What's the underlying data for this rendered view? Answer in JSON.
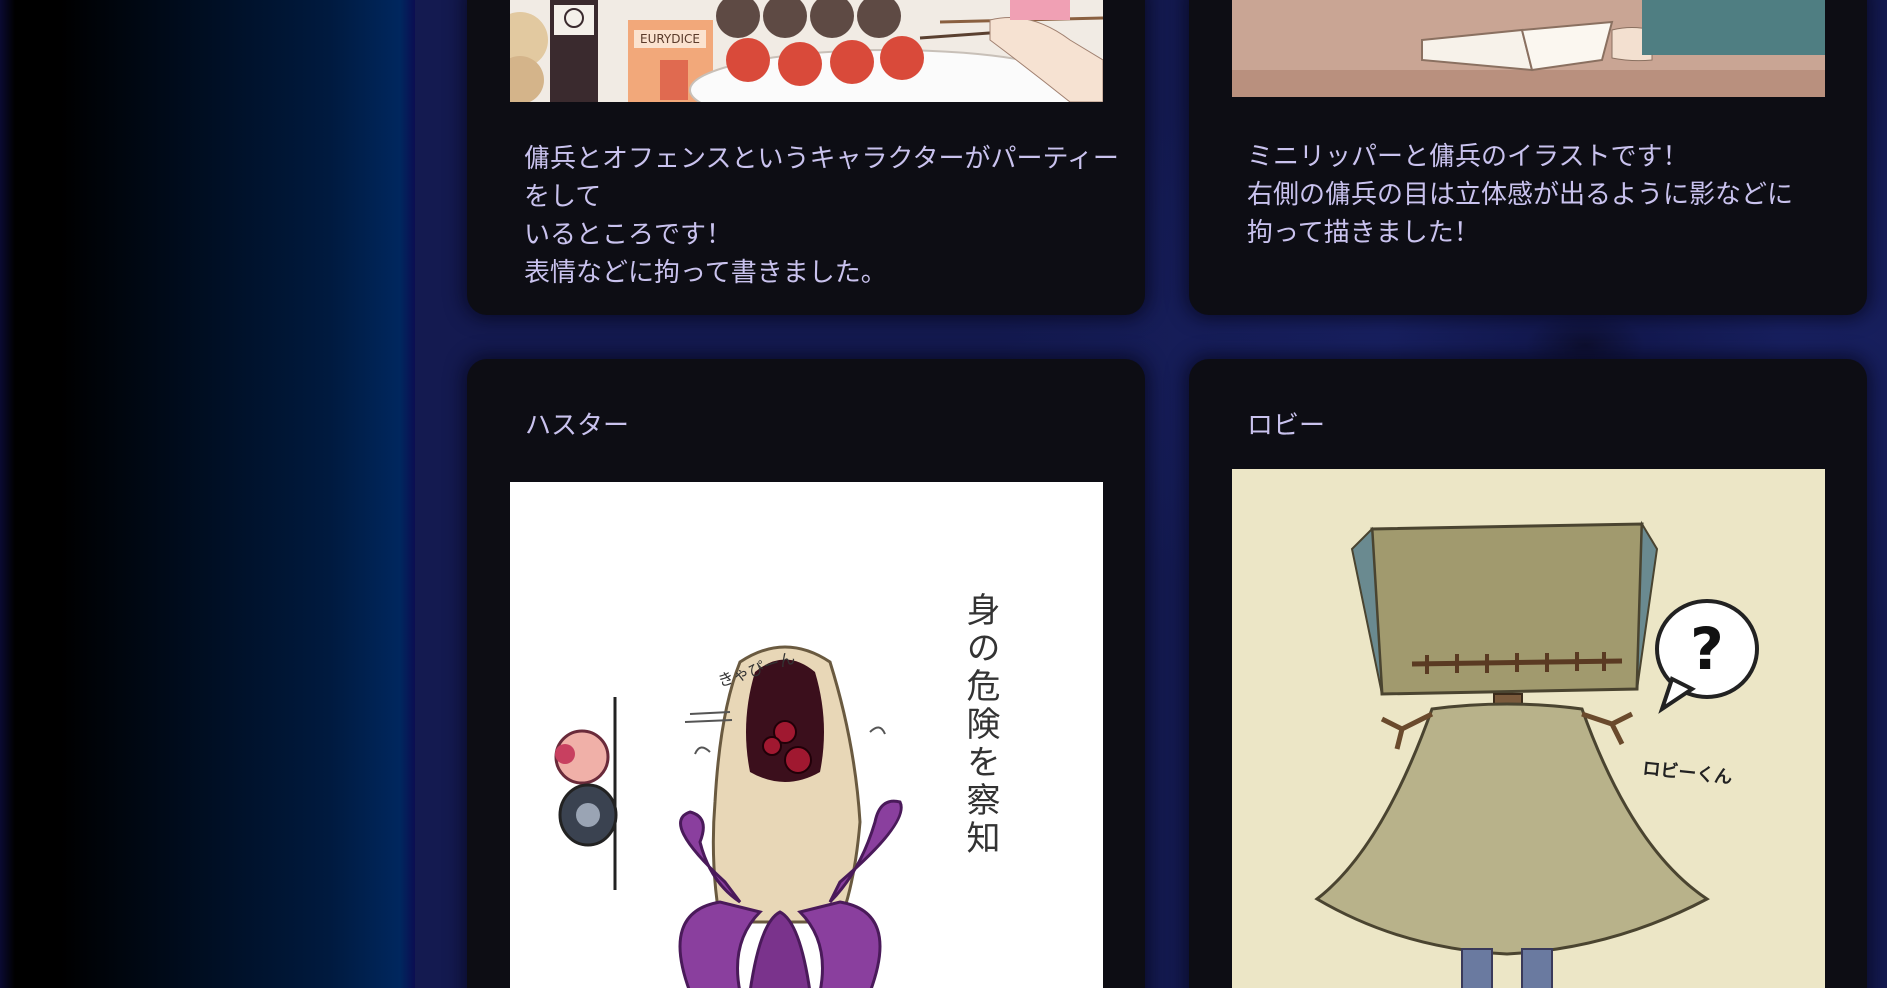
{
  "cards": [
    {
      "id": "party",
      "description": "傭兵とオフェンスというキャラクターがパーティーをして\nいるところです！\n表情などに拘って書きました。",
      "image": {
        "label_text": "EURYDICE"
      }
    },
    {
      "id": "minilipper",
      "description": "ミニリッパーと傭兵のイラストです！\n右側の傭兵の目は立体感が出るように影などに\n拘って描きました！"
    },
    {
      "id": "hastur",
      "title": "ハスター",
      "image": {
        "text_sound": "きゃぴーん",
        "text_vertical": "身の危険を察知"
      }
    },
    {
      "id": "robbie",
      "title": "ロビー",
      "image": {
        "text_question": "?",
        "text_name": "ロビーくん"
      }
    }
  ],
  "colors": {
    "card_bg": "#0d0d14",
    "text": "#c9c2ee",
    "page_bg": "#141a50",
    "hastur_tentacle": "#8a3f9e",
    "robbie_cloak": "#b8b28a",
    "robbie_bg": "#ece6c6"
  }
}
